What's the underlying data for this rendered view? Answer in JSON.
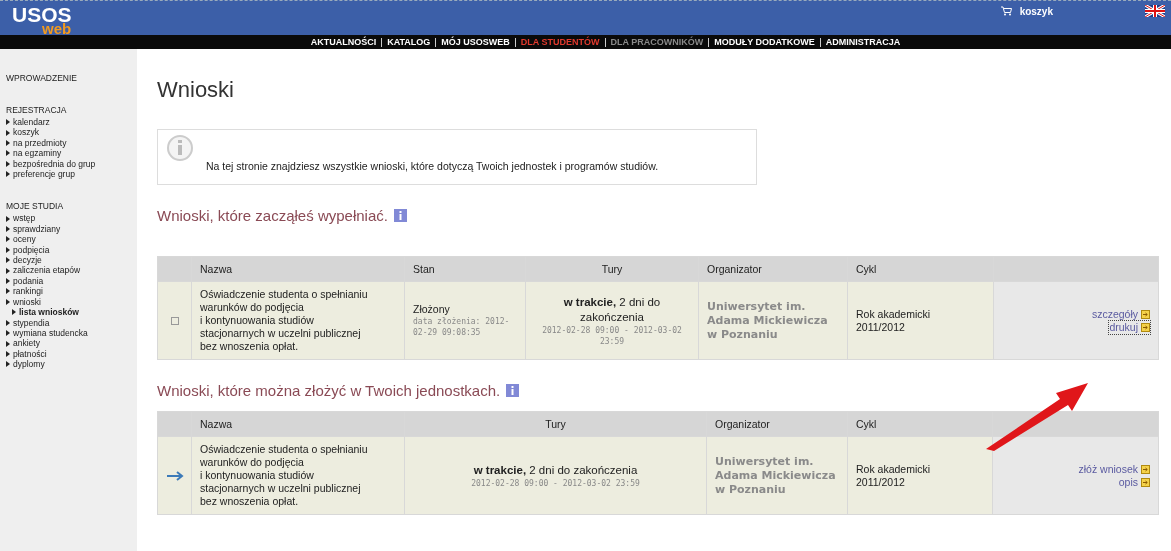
{
  "header": {
    "logo_top": "USOS",
    "logo_bottom": "web",
    "cart_label": "koszyk",
    "nav": [
      {
        "label": "AKTUALNOŚCI",
        "selected": false,
        "disabled": false
      },
      {
        "label": "KATALOG",
        "selected": false,
        "disabled": false
      },
      {
        "label": "MÓJ USOSWEB",
        "selected": false,
        "disabled": false
      },
      {
        "label": "DLA STUDENTÓW",
        "selected": true,
        "disabled": false
      },
      {
        "label": "DLA PRACOWNIKÓW",
        "selected": false,
        "disabled": true
      },
      {
        "label": "MODUŁY DODATKOWE",
        "selected": false,
        "disabled": false
      },
      {
        "label": "ADMINISTRACJA",
        "selected": false,
        "disabled": false
      }
    ]
  },
  "sidebar": {
    "sections": [
      {
        "title": "WPROWADZENIE"
      },
      {
        "title": "REJESTRACJA",
        "items": [
          {
            "label": "kalendarz",
            "selected": false
          },
          {
            "label": "koszyk",
            "selected": false
          },
          {
            "label": "na przedmioty",
            "selected": false
          },
          {
            "label": "na egzaminy",
            "selected": false
          },
          {
            "label": "bezpośrednia do grup",
            "selected": false
          },
          {
            "label": "preferencje grup",
            "selected": false
          }
        ]
      },
      {
        "title": "MOJE STUDIA",
        "items": [
          {
            "label": "wstęp",
            "selected": false
          },
          {
            "label": "sprawdziany",
            "selected": false
          },
          {
            "label": "oceny",
            "selected": false
          },
          {
            "label": "podpięcia",
            "selected": false
          },
          {
            "label": "decyzje",
            "selected": false
          },
          {
            "label": "zaliczenia etapów",
            "selected": false
          },
          {
            "label": "podania",
            "selected": false
          },
          {
            "label": "rankingi",
            "selected": false
          },
          {
            "label": "wnioski",
            "selected": false,
            "children": [
              {
                "label": "lista wniosków",
                "selected": true
              }
            ]
          },
          {
            "label": "stypendia",
            "selected": false
          },
          {
            "label": "wymiana studencka",
            "selected": false
          },
          {
            "label": "ankiety",
            "selected": false
          },
          {
            "label": "płatności",
            "selected": false
          },
          {
            "label": "dyplomy",
            "selected": false
          }
        ]
      }
    ]
  },
  "page_title": "Wnioski",
  "info_text": "Na tej stronie znajdziesz wszystkie wnioski, które dotyczą Twoich jednostek i programów studiów.",
  "tables": [
    {
      "heading": "Wnioski, które zacząłeś wypełniać.",
      "columns": [
        "",
        "Nazwa",
        "Stan",
        "Tury",
        "Organizator",
        "Cykl",
        ""
      ],
      "rows": [
        {
          "kind": "checkbox",
          "checked": false,
          "name": "Oświadczenie studenta o spełnianiu warunków do podjęcia\ni kontynuowania studiów stacjonarnych w uczelni publicznej bez wnoszenia opłat.",
          "status": "Złożony",
          "status_note": "data złożenia: 2012-02-29 09:08:35",
          "tury": "**w trakcie,** 2 dni do zakończenia",
          "tury_dates": "2012-02-28 09:00 - 2012-03-02 23:59",
          "organizer": "Uniwersytet im. Adama Mickiewicza w Poznaniu",
          "cycle": "Rok akademicki 2011/2012",
          "actions": [
            {
              "label": "szczegóły",
              "focused": false
            },
            {
              "label": "drukuj",
              "focused": true
            }
          ]
        }
      ]
    },
    {
      "heading": "Wnioski, które można złożyć w Twoich jednostkach.",
      "columns": [
        "",
        "Nazwa",
        "Tury",
        "Organizator",
        "Cykl",
        ""
      ],
      "rows": [
        {
          "kind": "arrow",
          "name": "Oświadczenie studenta o spełnianiu warunków do podjęcia\ni kontynuowania studiów stacjonarnych w uczelni publicznej bez wnoszenia opłat.",
          "tury": "**w trakcie,** 2 dni do zakończenia",
          "tury_dates": "2012-02-28 09:00 - 2012-03-02 23:59",
          "organizer": "Uniwersytet im. Adama Mickiewicza w Poznaniu",
          "cycle": "Rok akademicki 2011/2012",
          "actions": [
            {
              "label": "złóż wniosek",
              "focused": false
            },
            {
              "label": "opis",
              "focused": false
            }
          ]
        }
      ]
    }
  ]
}
